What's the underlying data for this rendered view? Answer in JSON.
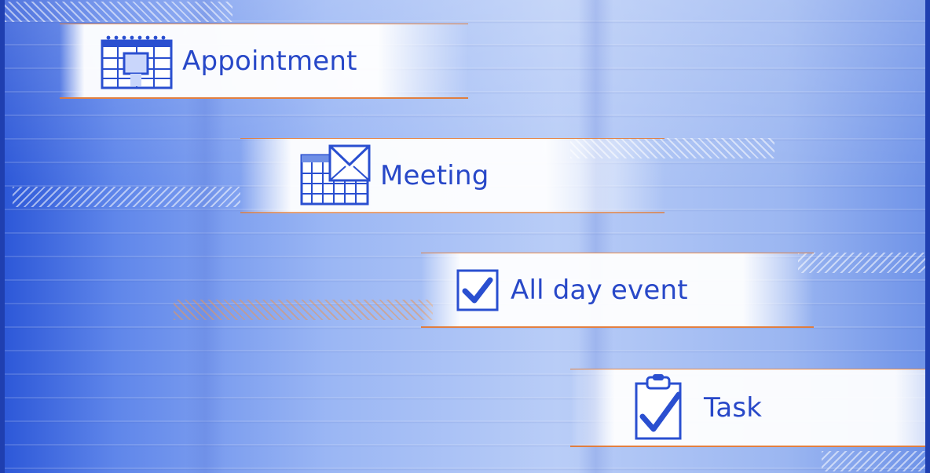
{
  "items": [
    {
      "label": "Appointment",
      "icon": "calendar-day-icon"
    },
    {
      "label": "Meeting",
      "icon": "meeting-request-icon"
    },
    {
      "label": "All day event",
      "icon": "checkbox-checked-icon"
    },
    {
      "label": "Task",
      "icon": "clipboard-check-icon"
    }
  ],
  "colors": {
    "background": "#9ab6f4",
    "frame": "#1f3fb0",
    "accent_text": "#2848c8",
    "rule": "#e27a36"
  }
}
